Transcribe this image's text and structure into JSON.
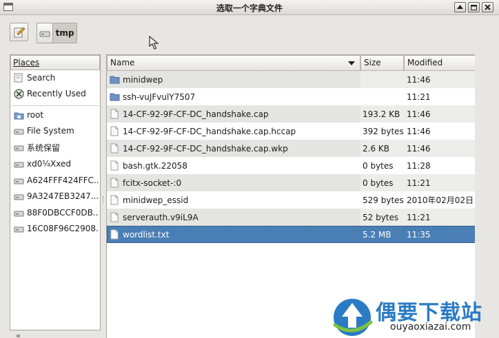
{
  "window": {
    "title": "选取一个字典文件",
    "buttons": [
      "roll-up",
      "maximize",
      "close"
    ]
  },
  "toolbar": {
    "edit_location_icon": "pencil-icon",
    "path": [
      "tmp"
    ]
  },
  "places": {
    "header": "Places",
    "items": [
      {
        "label": "Search",
        "icon": "search-icon"
      },
      {
        "label": "Recently Used",
        "icon": "recent-icon"
      },
      {
        "label": "root",
        "icon": "home-folder-icon"
      },
      {
        "label": "File System",
        "icon": "drive-icon"
      },
      {
        "label": "系统保留",
        "icon": "drive-icon"
      },
      {
        "label": "xd0¼Xxed",
        "icon": "drive-icon"
      },
      {
        "label": "A624FFF424FFC...",
        "icon": "drive-icon"
      },
      {
        "label": "9A3247EB3247...",
        "icon": "drive-icon"
      },
      {
        "label": "88F0DBCCF0DB...",
        "icon": "drive-icon"
      },
      {
        "label": "16C08F96C2908...",
        "icon": "drive-icon"
      }
    ]
  },
  "files": {
    "columns": {
      "name": "Name",
      "size": "Size",
      "modified": "Modified"
    },
    "rows": [
      {
        "name": "minidwep",
        "size": "",
        "modified": "11:46",
        "type": "folder"
      },
      {
        "name": "ssh-vuJFvulY7507",
        "size": "",
        "modified": "11:21",
        "type": "folder"
      },
      {
        "name": "14-CF-92-9F-CF-DC_handshake.cap",
        "size": "193.2 KB",
        "modified": "11:46",
        "type": "file"
      },
      {
        "name": "14-CF-92-9F-CF-DC_handshake.cap.hccap",
        "size": "392 bytes",
        "modified": "11:46",
        "type": "file"
      },
      {
        "name": "14-CF-92-9F-CF-DC_handshake.cap.wkp",
        "size": "2.6 KB",
        "modified": "11:46",
        "type": "file"
      },
      {
        "name": "bash.gtk.22058",
        "size": "0 bytes",
        "modified": "11:28",
        "type": "file"
      },
      {
        "name": "fcitx-socket-:0",
        "size": "0 bytes",
        "modified": "11:21",
        "type": "file"
      },
      {
        "name": "minidwep_essid",
        "size": "529 bytes",
        "modified": "2010年02月02日",
        "type": "file"
      },
      {
        "name": "serverauth.v9iL9A",
        "size": "52 bytes",
        "modified": "11:21",
        "type": "file"
      },
      {
        "name": "wordlist.txt",
        "size": "5.2 MB",
        "modified": "11:35",
        "type": "file",
        "selected": true
      }
    ]
  },
  "watermark": {
    "title": "偶要下载站",
    "url": "ouyaoxiazai.com"
  },
  "colors": {
    "selection": "#4a7fb6",
    "folder": "#6e93c2",
    "watermark_blue": "#2a7bc4"
  }
}
